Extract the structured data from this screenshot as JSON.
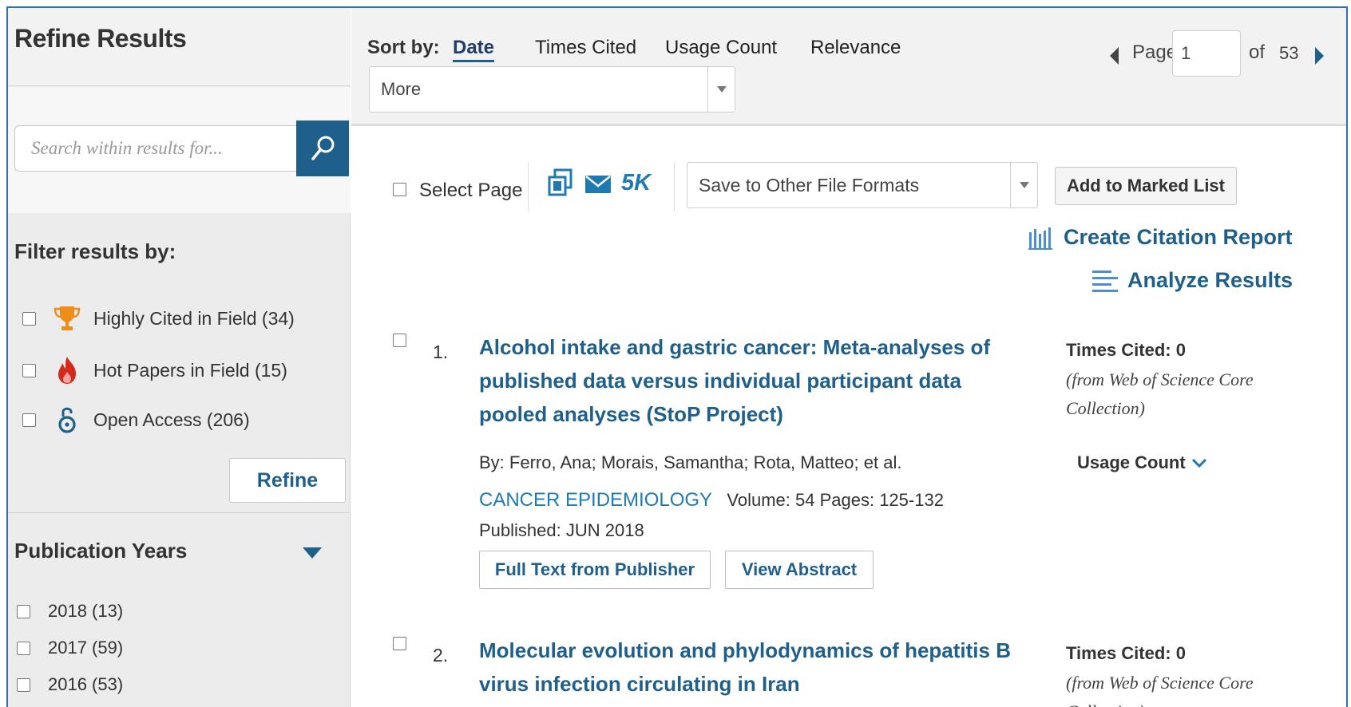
{
  "sidebar": {
    "title": "Refine Results",
    "search_placeholder": "Search within results for...",
    "filter_heading": "Filter results by:",
    "filters": [
      {
        "label": "Highly Cited in Field (34)",
        "icon": "trophy-icon"
      },
      {
        "label": "Hot Papers in Field (15)",
        "icon": "flame-icon"
      },
      {
        "label": "Open Access (206)",
        "icon": "open-access-icon"
      }
    ],
    "refine_label": "Refine",
    "pub_years_heading": "Publication Years",
    "years": [
      "2018 (13)",
      "2017 (59)",
      "2016 (53)"
    ]
  },
  "sort": {
    "label": "Sort by:",
    "options": [
      "Date",
      "Times Cited",
      "Usage Count",
      "Relevance"
    ],
    "active": "Date",
    "more_label": "More"
  },
  "pager": {
    "page_label": "Page",
    "current": "1",
    "of_label": "of",
    "total": "53"
  },
  "toolbar": {
    "select_page": "Select Page",
    "badge_5k": "5K",
    "save_formats": "Save to Other File Formats",
    "add_marked": "Add to Marked List",
    "citation_report": "Create Citation Report",
    "analyze_results": "Analyze Results"
  },
  "results": [
    {
      "num": "1.",
      "title": "Alcohol intake and gastric cancer: Meta-analyses of published data versus individual participant data pooled analyses (StoP Project)",
      "by": "By: Ferro, Ana; Morais, Samantha; Rota, Matteo; et al.",
      "journal": "CANCER EPIDEMIOLOGY",
      "details": "Volume: 54   Pages: 125-132   Published: JUN 2018",
      "times_cited": "Times Cited: 0",
      "from": "(from Web of Science Core Collection)",
      "usage": "Usage Count",
      "btn_fulltext": "Full Text from Publisher",
      "btn_abstract": "View Abstract"
    },
    {
      "num": "2.",
      "title": "Molecular evolution and phylodynamics of hepatitis B virus infection circulating in Iran",
      "times_cited": "Times Cited: 0",
      "from": "(from Web of Science Core Collection)"
    }
  ],
  "colors": {
    "accent": "#1f5f8c",
    "link": "#1f7ab3",
    "frame": "#2f6fb6"
  }
}
